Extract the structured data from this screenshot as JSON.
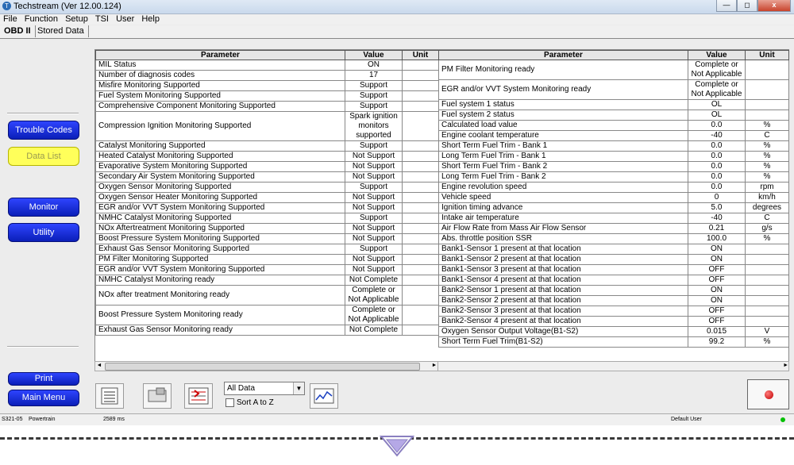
{
  "window": {
    "title": "Techstream (Ver 12.00.124)",
    "minimize": "—",
    "maximize": "◻",
    "close": "x"
  },
  "menu": [
    "File",
    "Function",
    "Setup",
    "TSI",
    "User",
    "Help"
  ],
  "tabs": [
    "OBD II",
    "Stored Data"
  ],
  "sidebar": {
    "trouble_codes": "Trouble Codes",
    "data_list": "Data List",
    "monitor": "Monitor",
    "utility": "Utility",
    "print": "Print",
    "main_menu": "Main Menu"
  },
  "headers": {
    "parameter": "Parameter",
    "value": "Value",
    "unit": "Unit"
  },
  "left_rows": [
    {
      "p": "MIL Status",
      "v": "ON",
      "u": ""
    },
    {
      "p": "Number of diagnosis codes",
      "v": "17",
      "u": ""
    },
    {
      "p": "Misfire Monitoring Supported",
      "v": "Support",
      "u": ""
    },
    {
      "p": "Fuel System Monitoring Supported",
      "v": "Support",
      "u": ""
    },
    {
      "p": "Comprehensive Component Monitoring Supported",
      "v": "Support",
      "u": ""
    },
    {
      "p": "Compression Ignition Monitoring Supported",
      "v": "Spark ignition monitors supported",
      "u": ""
    },
    {
      "p": "Catalyst Monitoring Supported",
      "v": "Support",
      "u": ""
    },
    {
      "p": "Heated Catalyst Monitoring Supported",
      "v": "Not Support",
      "u": ""
    },
    {
      "p": "Evaporative System Monitoring Supported",
      "v": "Not Support",
      "u": ""
    },
    {
      "p": "Secondary Air System Monitoring Supported",
      "v": "Not Support",
      "u": ""
    },
    {
      "p": "Oxygen Sensor Monitoring Supported",
      "v": "Support",
      "u": ""
    },
    {
      "p": "Oxygen Sensor Heater Monitoring Supported",
      "v": "Not Support",
      "u": ""
    },
    {
      "p": "EGR and/or VVT System Monitoring Supported",
      "v": "Not Support",
      "u": ""
    },
    {
      "p": "NMHC Catalyst Monitoring Supported",
      "v": "Support",
      "u": ""
    },
    {
      "p": "NOx Aftertreatment Monitoring Supported",
      "v": "Not Support",
      "u": ""
    },
    {
      "p": "Boost Pressure System Monitoring Supported",
      "v": "Not Support",
      "u": ""
    },
    {
      "p": "Exhaust Gas Sensor Monitoring Supported",
      "v": "Support",
      "u": ""
    },
    {
      "p": "PM Filter Monitoring Supported",
      "v": "Not Support",
      "u": ""
    },
    {
      "p": "EGR and/or VVT System Monitoring Supported",
      "v": "Not Support",
      "u": ""
    },
    {
      "p": "NMHC Catalyst Monitoring ready",
      "v": "Not Complete",
      "u": ""
    },
    {
      "p": "NOx after treatment Monitoring ready",
      "v": "Complete or Not Applicable",
      "u": ""
    },
    {
      "p": "Boost Pressure System Monitoring ready",
      "v": "Complete or Not Applicable",
      "u": ""
    },
    {
      "p": "Exhaust Gas Sensor Monitoring ready",
      "v": "Not Complete",
      "u": ""
    }
  ],
  "right_rows": [
    {
      "p": "PM Filter Monitoring ready",
      "v": "Complete or Not Applicable",
      "u": ""
    },
    {
      "p": "EGR and/or VVT System Monitoring ready",
      "v": "Complete or Not Applicable",
      "u": ""
    },
    {
      "p": "Fuel system 1 status",
      "v": "OL",
      "u": ""
    },
    {
      "p": "Fuel system 2 status",
      "v": "OL",
      "u": ""
    },
    {
      "p": "Calculated load value",
      "v": "0.0",
      "u": "%"
    },
    {
      "p": "Engine coolant temperature",
      "v": "-40",
      "u": "C"
    },
    {
      "p": "Short Term Fuel Trim - Bank 1",
      "v": "0.0",
      "u": "%"
    },
    {
      "p": "Long Term Fuel Trim - Bank 1",
      "v": "0.0",
      "u": "%"
    },
    {
      "p": "Short Term Fuel Trim - Bank 2",
      "v": "0.0",
      "u": "%"
    },
    {
      "p": "Long Term Fuel Trim - Bank 2",
      "v": "0.0",
      "u": "%"
    },
    {
      "p": "Engine revolution speed",
      "v": "0.0",
      "u": "rpm"
    },
    {
      "p": "Vehicle speed",
      "v": "0",
      "u": "km/h"
    },
    {
      "p": "Ignition timing advance",
      "v": "5.0",
      "u": "degrees"
    },
    {
      "p": "Intake air temperature",
      "v": "-40",
      "u": "C"
    },
    {
      "p": "Air Flow Rate from Mass Air Flow Sensor",
      "v": "0.21",
      "u": "g/s"
    },
    {
      "p": "Abs. throttle position SSR",
      "v": "100.0",
      "u": "%"
    },
    {
      "p": "Bank1-Sensor 1 present at that location",
      "v": "ON",
      "u": ""
    },
    {
      "p": "Bank1-Sensor 2 present at that location",
      "v": "ON",
      "u": ""
    },
    {
      "p": "Bank1-Sensor 3 present at that location",
      "v": "OFF",
      "u": ""
    },
    {
      "p": "Bank1-Sensor 4 present at that location",
      "v": "OFF",
      "u": ""
    },
    {
      "p": "Bank2-Sensor 1 present at that location",
      "v": "ON",
      "u": ""
    },
    {
      "p": "Bank2-Sensor 2 present at that location",
      "v": "ON",
      "u": ""
    },
    {
      "p": "Bank2-Sensor 3 present at that location",
      "v": "OFF",
      "u": ""
    },
    {
      "p": "Bank2-Sensor 4 present at that location",
      "v": "OFF",
      "u": ""
    },
    {
      "p": "Oxygen Sensor Output Voltage(B1-S2)",
      "v": "0.015",
      "u": "V"
    },
    {
      "p": "Short Term Fuel Trim(B1-S2)",
      "v": "99.2",
      "u": "%"
    }
  ],
  "toolbar": {
    "select_value": "All Data",
    "sort_label": "Sort A to Z"
  },
  "status": {
    "ecu": "S321-05",
    "system": "Powertrain",
    "time": "2589 ms",
    "user": "Default User"
  },
  "colors": {
    "accent": "#0b1fb8",
    "highlight": "#ffff5a",
    "record": "#c00000",
    "connected": "#00c000"
  }
}
